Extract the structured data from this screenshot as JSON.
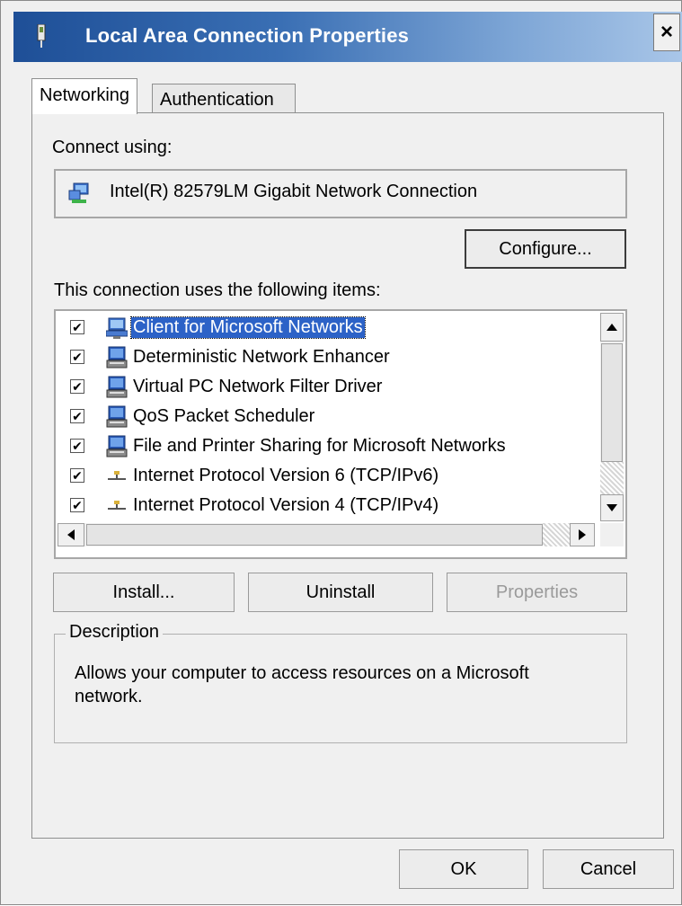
{
  "window": {
    "title": "Local Area Connection Properties",
    "close_label": "×",
    "title_icon": "network-connection-icon"
  },
  "tabs": [
    {
      "label": "Networking",
      "active": true
    },
    {
      "label": "Authentication",
      "active": false
    }
  ],
  "networking": {
    "connect_using_label": "Connect using:",
    "adapter": {
      "name": "Intel(R) 82579LM Gigabit Network Connection",
      "icon": "network-adapter-icon"
    },
    "configure_label": "Configure...",
    "items_label": "This connection uses the following items:",
    "items": [
      {
        "label": "Client for Microsoft Networks",
        "checked": true,
        "selected": true,
        "icon": "network-client-icon"
      },
      {
        "label": "Deterministic Network Enhancer",
        "checked": true,
        "selected": false,
        "icon": "network-service-icon"
      },
      {
        "label": "Virtual PC Network Filter Driver",
        "checked": true,
        "selected": false,
        "icon": "network-service-icon"
      },
      {
        "label": "QoS Packet Scheduler",
        "checked": true,
        "selected": false,
        "icon": "network-service-icon"
      },
      {
        "label": "File and Printer Sharing for Microsoft Networks",
        "checked": true,
        "selected": false,
        "icon": "network-service-icon"
      },
      {
        "label": "Internet Protocol Version 6 (TCP/IPv6)",
        "checked": true,
        "selected": false,
        "icon": "protocol-icon"
      },
      {
        "label": "Internet Protocol Version 4 (TCP/IPv4)",
        "checked": true,
        "selected": false,
        "icon": "protocol-icon"
      }
    ],
    "install_label": "Install...",
    "uninstall_label": "Uninstall",
    "properties_label": "Properties",
    "description_title": "Description",
    "description_text": "Allows your computer to access resources on a Microsoft network."
  },
  "footer": {
    "ok_label": "OK",
    "cancel_label": "Cancel"
  },
  "colors": {
    "titlebar_start": "#1e4f97",
    "selection": "#2c62c7",
    "dialog_bg": "#f0f0f0"
  }
}
